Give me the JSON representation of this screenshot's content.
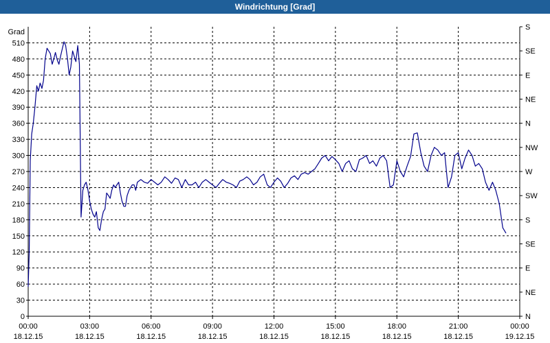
{
  "window": {
    "title": "Windrichtung [Grad]"
  },
  "chart_data": {
    "type": "line",
    "title": "Windrichtung [Grad]",
    "ylabel": "Grad",
    "xlabel": "",
    "ylim": [
      0,
      540
    ],
    "xlim_hours": [
      0,
      24
    ],
    "grid": true,
    "y_ticks": [
      0,
      30,
      60,
      90,
      120,
      150,
      180,
      210,
      240,
      270,
      300,
      330,
      360,
      390,
      420,
      450,
      480,
      510
    ],
    "y_tick_labels": [
      "0",
      "30",
      "60",
      "90",
      "120",
      "150",
      "180",
      "210",
      "240",
      "270",
      "300",
      "330",
      "360",
      "390",
      "420",
      "450",
      "480",
      "510"
    ],
    "right_axis": {
      "values": [
        0,
        45,
        90,
        135,
        180,
        225,
        270,
        315,
        360,
        405,
        450,
        495,
        540
      ],
      "labels": [
        "N",
        "NE",
        "E",
        "SE",
        "S",
        "SW",
        "W",
        "NW",
        "N",
        "NE",
        "E",
        "SE",
        "S"
      ]
    },
    "x_ticks": [
      {
        "time": "00:00",
        "date": "18.12.15"
      },
      {
        "time": "03:00",
        "date": "18.12.15"
      },
      {
        "time": "06:00",
        "date": "18.12.15"
      },
      {
        "time": "09:00",
        "date": "18.12.15"
      },
      {
        "time": "12:00",
        "date": "18.12.15"
      },
      {
        "time": "15:00",
        "date": "18.12.15"
      },
      {
        "time": "18:00",
        "date": "18.12.15"
      },
      {
        "time": "21:00",
        "date": "18.12.15"
      },
      {
        "time": "00:00",
        "date": "19.12.15"
      }
    ],
    "series": [
      {
        "name": "",
        "color": "#00008b",
        "x_hours": [
          0.0,
          0.05,
          0.1,
          0.17,
          0.25,
          0.33,
          0.42,
          0.5,
          0.58,
          0.67,
          0.75,
          0.83,
          0.92,
          1.0,
          1.08,
          1.17,
          1.25,
          1.33,
          1.42,
          1.5,
          1.58,
          1.67,
          1.75,
          1.83,
          1.92,
          2.0,
          2.08,
          2.17,
          2.25,
          2.33,
          2.42,
          2.5,
          2.58,
          2.67,
          2.75,
          2.83,
          2.92,
          3.0,
          3.08,
          3.17,
          3.25,
          3.33,
          3.42,
          3.5,
          3.58,
          3.67,
          3.75,
          3.83,
          3.92,
          4.0,
          4.08,
          4.17,
          4.25,
          4.33,
          4.42,
          4.5,
          4.58,
          4.67,
          4.75,
          4.83,
          4.92,
          5.0,
          5.08,
          5.17,
          5.25,
          5.33,
          5.5,
          5.67,
          5.83,
          6.0,
          6.17,
          6.33,
          6.5,
          6.67,
          6.83,
          7.0,
          7.17,
          7.33,
          7.5,
          7.67,
          7.83,
          8.0,
          8.17,
          8.33,
          8.5,
          8.67,
          8.83,
          9.0,
          9.17,
          9.33,
          9.5,
          9.67,
          9.83,
          10.0,
          10.17,
          10.33,
          10.5,
          10.67,
          10.83,
          11.0,
          11.17,
          11.33,
          11.5,
          11.67,
          11.83,
          12.0,
          12.17,
          12.33,
          12.5,
          12.67,
          12.83,
          13.0,
          13.17,
          13.33,
          13.5,
          13.67,
          13.83,
          14.0,
          14.17,
          14.33,
          14.5,
          14.67,
          14.83,
          15.0,
          15.17,
          15.33,
          15.5,
          15.67,
          15.83,
          16.0,
          16.17,
          16.33,
          16.5,
          16.67,
          16.83,
          17.0,
          17.17,
          17.33,
          17.5,
          17.67,
          17.83,
          18.0,
          18.17,
          18.33,
          18.5,
          18.67,
          18.83,
          19.0,
          19.17,
          19.33,
          19.5,
          19.67,
          19.83,
          20.0,
          20.17,
          20.33,
          20.5,
          20.67,
          20.83,
          21.0,
          21.17,
          21.33,
          21.5,
          21.67,
          21.83,
          22.0,
          22.17,
          22.33,
          22.5,
          22.67,
          22.83,
          23.0,
          23.17,
          23.33,
          23.5,
          23.67,
          23.83,
          24.0,
          24.1
        ],
        "values": [
          55,
          120,
          290,
          340,
          360,
          390,
          430,
          420,
          435,
          425,
          440,
          480,
          500,
          495,
          490,
          470,
          480,
          492,
          478,
          470,
          485,
          500,
          512,
          505,
          480,
          450,
          465,
          495,
          485,
          475,
          505,
          470,
          185,
          235,
          245,
          250,
          235,
          215,
          200,
          190,
          185,
          195,
          165,
          160,
          180,
          195,
          200,
          230,
          225,
          220,
          235,
          245,
          240,
          245,
          250,
          230,
          215,
          205,
          205,
          225,
          235,
          240,
          245,
          245,
          235,
          250,
          255,
          250,
          248,
          255,
          250,
          245,
          250,
          260,
          255,
          248,
          258,
          255,
          240,
          255,
          245,
          245,
          250,
          240,
          250,
          255,
          250,
          245,
          240,
          248,
          255,
          250,
          248,
          245,
          240,
          252,
          255,
          260,
          255,
          245,
          250,
          260,
          265,
          245,
          240,
          250,
          258,
          252,
          240,
          248,
          258,
          262,
          255,
          265,
          268,
          265,
          270,
          275,
          285,
          295,
          300,
          290,
          298,
          292,
          285,
          270,
          285,
          290,
          275,
          270,
          292,
          295,
          300,
          285,
          290,
          280,
          295,
          300,
          290,
          240,
          245,
          290,
          270,
          260,
          280,
          298,
          340,
          342,
          305,
          280,
          270,
          300,
          315,
          310,
          300,
          305,
          240,
          260,
          300,
          305,
          275,
          295,
          310,
          300,
          280,
          285,
          275,
          250,
          235,
          250,
          235,
          210,
          165,
          155
        ]
      }
    ]
  }
}
